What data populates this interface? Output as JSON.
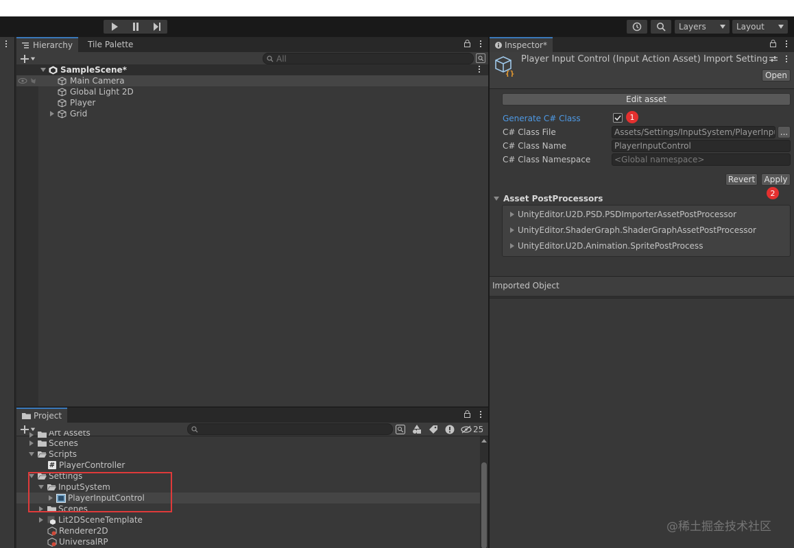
{
  "toolbar": {
    "layers_label": "Layers",
    "layout_label": "Layout"
  },
  "hierarchy": {
    "tab_label": "Hierarchy",
    "tab2_label": "Tile Palette",
    "search_placeholder": "All",
    "scene": "SampleScene*",
    "items": [
      "Main Camera",
      "Global Light 2D",
      "Player",
      "Grid"
    ]
  },
  "project": {
    "tab_label": "Project",
    "hidden_count": "25",
    "items": [
      {
        "label": "Art Assets"
      },
      {
        "label": "Scenes"
      },
      {
        "label": "Scripts"
      },
      {
        "label": "PlayerController"
      },
      {
        "label": "Settings"
      },
      {
        "label": "InputSystem"
      },
      {
        "label": "PlayerInputControl"
      },
      {
        "label": "Scenes"
      },
      {
        "label": "Lit2DSceneTemplate"
      },
      {
        "label": "Renderer2D"
      },
      {
        "label": "UniversalRP"
      }
    ]
  },
  "inspector": {
    "tab_label": "Inspector*",
    "title": "Player Input Control (Input Action Asset) Import Settings",
    "open_label": "Open",
    "edit_asset_label": "Edit asset",
    "generate_label": "Generate C# Class",
    "generate_checked": true,
    "class_file_label": "C# Class File",
    "class_file_value": "Assets/Settings/InputSystem/PlayerInputC",
    "browse_label": "...",
    "class_name_label": "C# Class Name",
    "class_name_value": "PlayerInputControl",
    "class_namespace_label": "C# Class Namespace",
    "class_namespace_placeholder": "<Global namespace>",
    "revert_label": "Revert",
    "apply_label": "Apply",
    "postprocessors_label": "Asset PostProcessors",
    "postprocessors": [
      "UnityEditor.U2D.PSD.PSDImporterAssetPostProcessor",
      "UnityEditor.ShaderGraph.ShaderGraphAssetPostProcessor",
      "UnityEditor.U2D.Animation.SpritePostProcess"
    ],
    "imported_object_label": "Imported Object"
  },
  "annotations": {
    "badge1": "1",
    "badge2": "2",
    "highlight_color": "#e03a3a"
  },
  "watermark": "@稀土掘金技术社区",
  "colors": {
    "accent": "#3a79bb",
    "link": "#4e9ae6",
    "selection": "#3e3e3e"
  }
}
